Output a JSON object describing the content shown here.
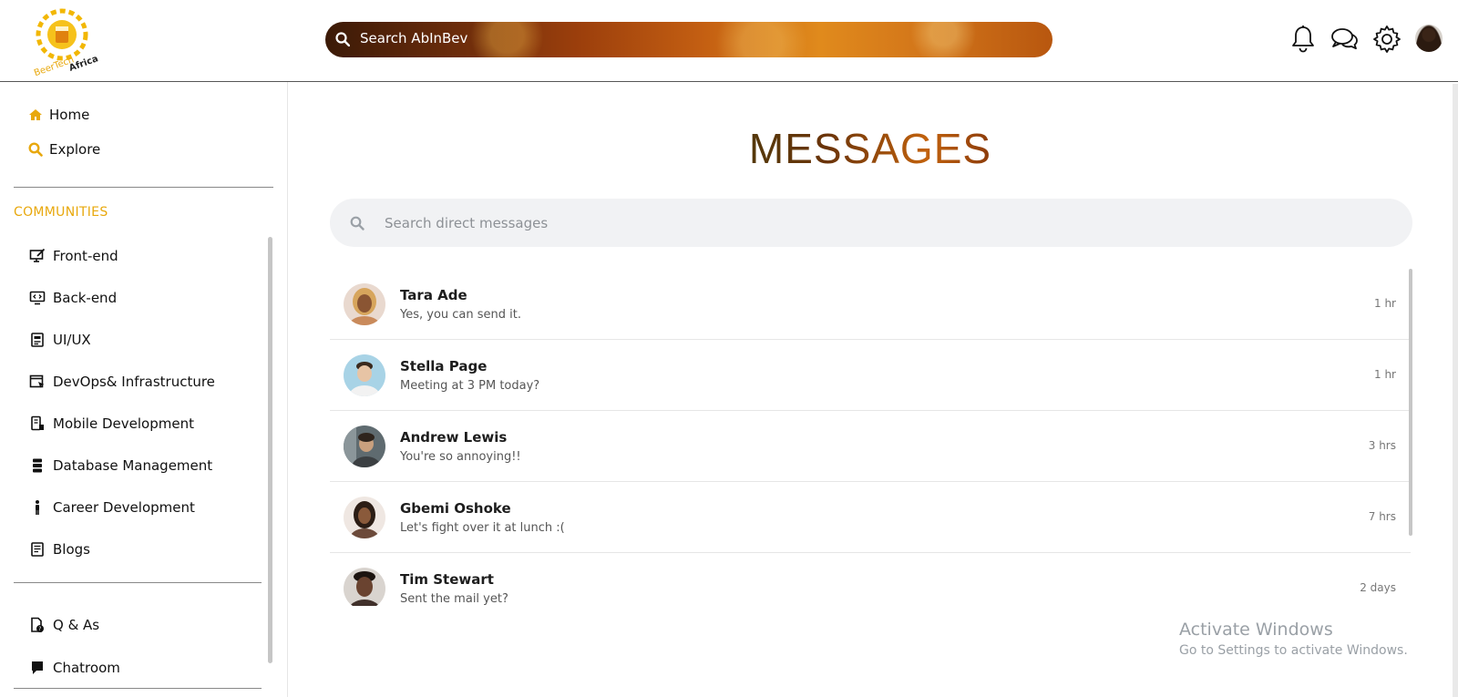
{
  "header": {
    "logo_text": "BeerTech Africa",
    "search_label": "Search AbInBev",
    "icons": [
      "bell-icon",
      "chat-icon",
      "gear-icon",
      "user-avatar"
    ]
  },
  "sidebar": {
    "nav": [
      {
        "label": "Home",
        "icon": "home-icon"
      },
      {
        "label": "Explore",
        "icon": "search-icon"
      }
    ],
    "communities_title": "COMMUNITIES",
    "communities": [
      {
        "label": "Front-end",
        "icon": "monitor-pen-icon"
      },
      {
        "label": "Back-end",
        "icon": "monitor-code-icon"
      },
      {
        "label": "UI/UX",
        "icon": "layout-icon"
      },
      {
        "label": "DevOps& Infrastructure",
        "icon": "window-cursor-icon"
      },
      {
        "label": "Mobile Development",
        "icon": "mobile-doc-icon"
      },
      {
        "label": "Database Management",
        "icon": "database-icon"
      },
      {
        "label": "Career Development",
        "icon": "person-icon"
      },
      {
        "label": "Blogs",
        "icon": "document-icon"
      }
    ],
    "extras": [
      {
        "label": "Q & As",
        "icon": "qa-doc-icon"
      },
      {
        "label": "Chatroom",
        "icon": "chat-bubble-icon"
      }
    ]
  },
  "main": {
    "title": "MESSAGES",
    "search_placeholder": "Search direct messages",
    "conversations": [
      {
        "name": "Tara Ade",
        "preview": "Yes, you can send it.",
        "time": "1 hr"
      },
      {
        "name": "Stella Page",
        "preview": "Meeting at 3 PM today?",
        "time": "1 hr"
      },
      {
        "name": "Andrew Lewis",
        "preview": "You're so annoying!!",
        "time": "3 hrs"
      },
      {
        "name": "Gbemi Oshoke",
        "preview": "Let's fight over it at lunch :(",
        "time": "7 hrs"
      },
      {
        "name": "Tim Stewart",
        "preview": "Sent the mail yet?",
        "time": "2 days"
      }
    ]
  },
  "watermark": {
    "line1": "Activate Windows",
    "line2": "Go to Settings to activate Windows."
  },
  "colors": {
    "accent": "#e8a80d",
    "title_gradient": [
      "#4e3a0c",
      "#c2620d"
    ],
    "search_bar_bg": "#f1f2f4"
  }
}
